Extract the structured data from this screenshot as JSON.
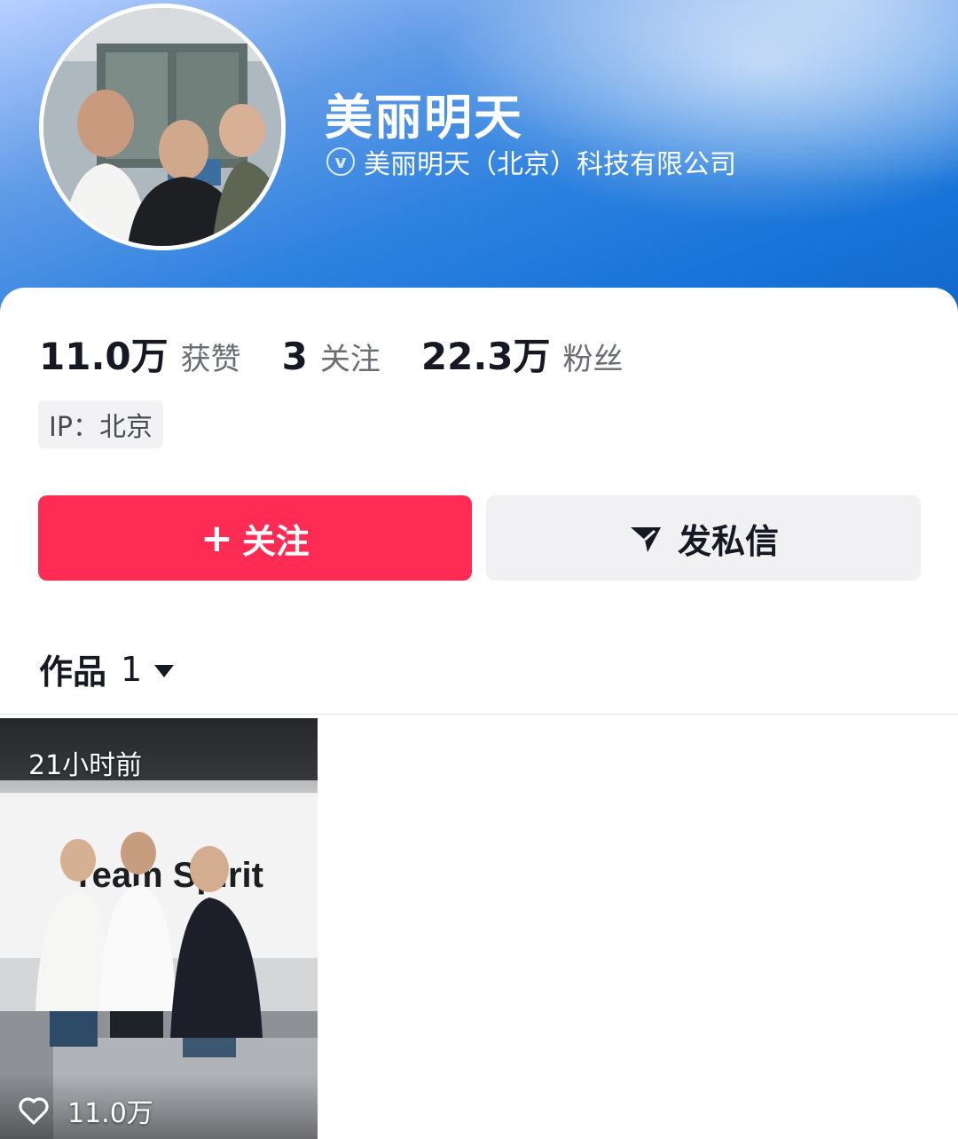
{
  "profile": {
    "name": "美丽明天",
    "verified_org": "美丽明天（北京）科技有限公司"
  },
  "stats": {
    "likes": {
      "value": "11.0万",
      "label": "获赞"
    },
    "following": {
      "value": "3",
      "label": "关注"
    },
    "followers": {
      "value": "22.3万",
      "label": "粉丝"
    }
  },
  "ip": "IP：北京",
  "actions": {
    "follow_plus": "+",
    "follow_label": "关注",
    "message_label": "发私信"
  },
  "works": {
    "tab_label": "作品",
    "count": "1"
  },
  "videos": [
    {
      "time": "21小时前",
      "likes": "11.0万"
    }
  ],
  "colors": {
    "accent": "#fe2c55",
    "header_blue": "#1774d8",
    "secondary_button": "#f1f1f3"
  }
}
